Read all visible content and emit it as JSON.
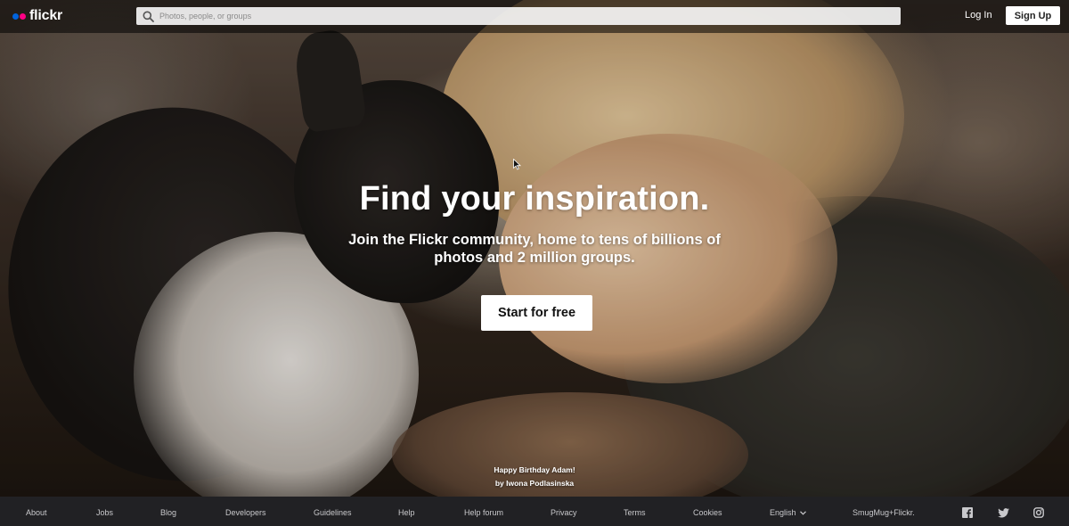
{
  "brand": {
    "logo_text": "flickr",
    "colors": {
      "blue": "#0063dc",
      "pink": "#ff0084"
    }
  },
  "search": {
    "placeholder": "Photos, people, or groups"
  },
  "header": {
    "login_label": "Log In",
    "signup_label": "Sign Up"
  },
  "hero": {
    "headline": "Find your inspiration.",
    "subline": "Join the Flickr community, home to tens of billions of photos and 2 million groups.",
    "cta_label": "Start for free",
    "photo_title": "Happy Birthday Adam!",
    "photo_author": "by Iwona Podlasinska"
  },
  "footer": {
    "links": {
      "about": "About",
      "jobs": "Jobs",
      "blog": "Blog",
      "developers": "Developers",
      "guidelines": "Guidelines",
      "help": "Help",
      "help_forum": "Help forum",
      "privacy": "Privacy",
      "terms": "Terms",
      "cookies": "Cookies"
    },
    "language": "English",
    "smugmug": "SmugMug+Flickr.",
    "social_icons": [
      "facebook-icon",
      "twitter-icon",
      "instagram-icon"
    ]
  }
}
